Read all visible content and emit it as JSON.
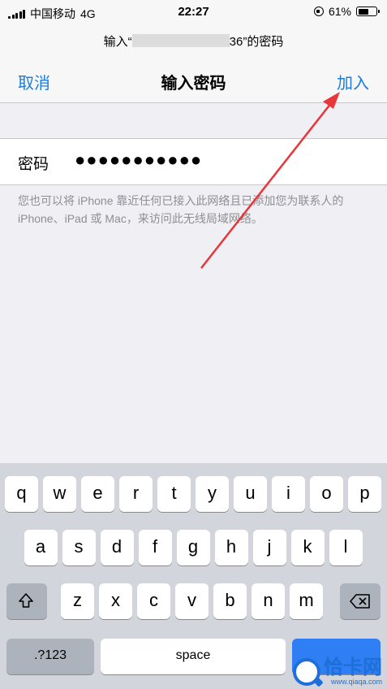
{
  "status_bar": {
    "carrier": "中国移动",
    "network": "4G",
    "time": "22:27",
    "battery": "61%",
    "battery_level": 0.61
  },
  "header": {
    "subtitle_prefix": "输入“",
    "subtitle_suffix": "36”的密码",
    "cancel": "取消",
    "title": "输入密码",
    "join": "加入"
  },
  "form": {
    "password_label": "密码",
    "password_value": "●●●●●●●●●●●",
    "hint": "您也可以将 iPhone 靠近任何已接入此网络且已添加您为联系人的 iPhone、iPad 或 Mac，来访问此无线局域网络。"
  },
  "keyboard": {
    "row1": [
      "q",
      "w",
      "e",
      "r",
      "t",
      "y",
      "u",
      "i",
      "o",
      "p"
    ],
    "row2": [
      "a",
      "s",
      "d",
      "f",
      "g",
      "h",
      "j",
      "k",
      "l"
    ],
    "row3": [
      "z",
      "x",
      "c",
      "v",
      "b",
      "n",
      "m"
    ],
    "numbers_key": ".?123",
    "space_key": "space"
  },
  "watermark": {
    "text": "恰卡网",
    "url": "www.qiaqa.com"
  },
  "colors": {
    "accent": "#1a7de0",
    "annotation_arrow": "#e8373a"
  }
}
